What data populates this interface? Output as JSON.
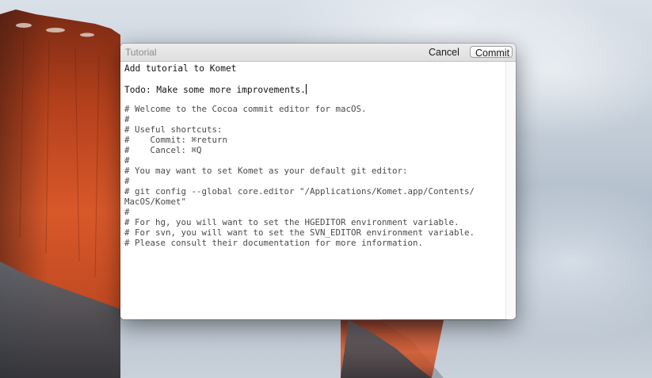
{
  "window": {
    "title": "Tutorial",
    "cancel_label": "Cancel",
    "commit_label": "Commit"
  },
  "editor": {
    "message_lines": [
      "Add tutorial to Komet",
      "Todo: Make some more improvements."
    ],
    "comment_lines": [
      "# Welcome to the Cocoa commit editor for macOS.",
      "#",
      "# Useful shortcuts:",
      "#    Commit: ⌘return",
      "#    Cancel: ⌘Q",
      "#",
      "# You may want to set Komet as your default git editor:",
      "#",
      "# git config --global core.editor \"/Applications/Komet.app/Contents/",
      "MacOS/Komet\"",
      "#",
      "# For hg, you will want to set the HGEDITOR environment variable.",
      "# For svn, you will want to set the SVN_EDITOR environment variable.",
      "# Please consult their documentation for more information."
    ]
  }
}
